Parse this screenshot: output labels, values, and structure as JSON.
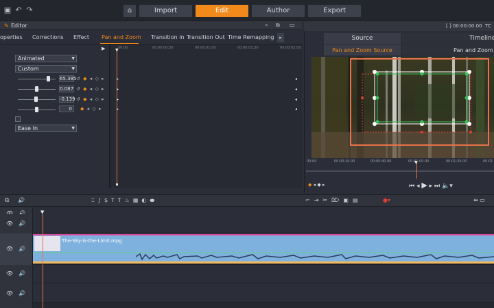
{
  "topbar": {
    "nav": [
      "Import",
      "Edit",
      "Author",
      "Export"
    ],
    "active_tab": "Edit",
    "accent": "#f28a1b"
  },
  "editor": {
    "title": "Editor",
    "tabs": [
      "operties",
      "Corrections",
      "Effect",
      "Pan and Zoom",
      "Transition In",
      "Transition Out",
      "Time Remapping"
    ],
    "active_tab": "Pan and Zoom",
    "mode_select": "Animated",
    "preset_select": "Custom",
    "params": [
      "65.385",
      "0.087",
      "-0.139",
      "0"
    ],
    "easing_select": "Ease In",
    "ruler_ticks": [
      "00:00",
      "00:00:00;30",
      "00:00:01;00",
      "00:00:01;30",
      "00:00:02;00"
    ]
  },
  "preview": {
    "timecode": "[ ] 00:00:00.00",
    "timecode_short": "TC",
    "tab_source": "Source",
    "tab_timeline": "Timeline",
    "sub_source": "Pan and Zoom Source",
    "sub_timeline": "Pan and Zoom",
    "ruler_ticks": [
      "00:00",
      "00:00:20.00",
      "00:00:40.00",
      "00:01:00.00",
      "00:01:20.00",
      "00:01"
    ]
  },
  "timeline": {
    "clip_name": "The-Sky-is-the-Limit.mpg",
    "clip_color": "#7fb1de",
    "marker_color": "#d9489b"
  },
  "icons": [
    "home-icon",
    "redo-icon",
    "undo-icon",
    "folder-icon",
    "pencil-icon",
    "play-icon",
    "eye-icon",
    "speaker-icon",
    "text-icon",
    "scissors-icon",
    "trash-icon"
  ]
}
